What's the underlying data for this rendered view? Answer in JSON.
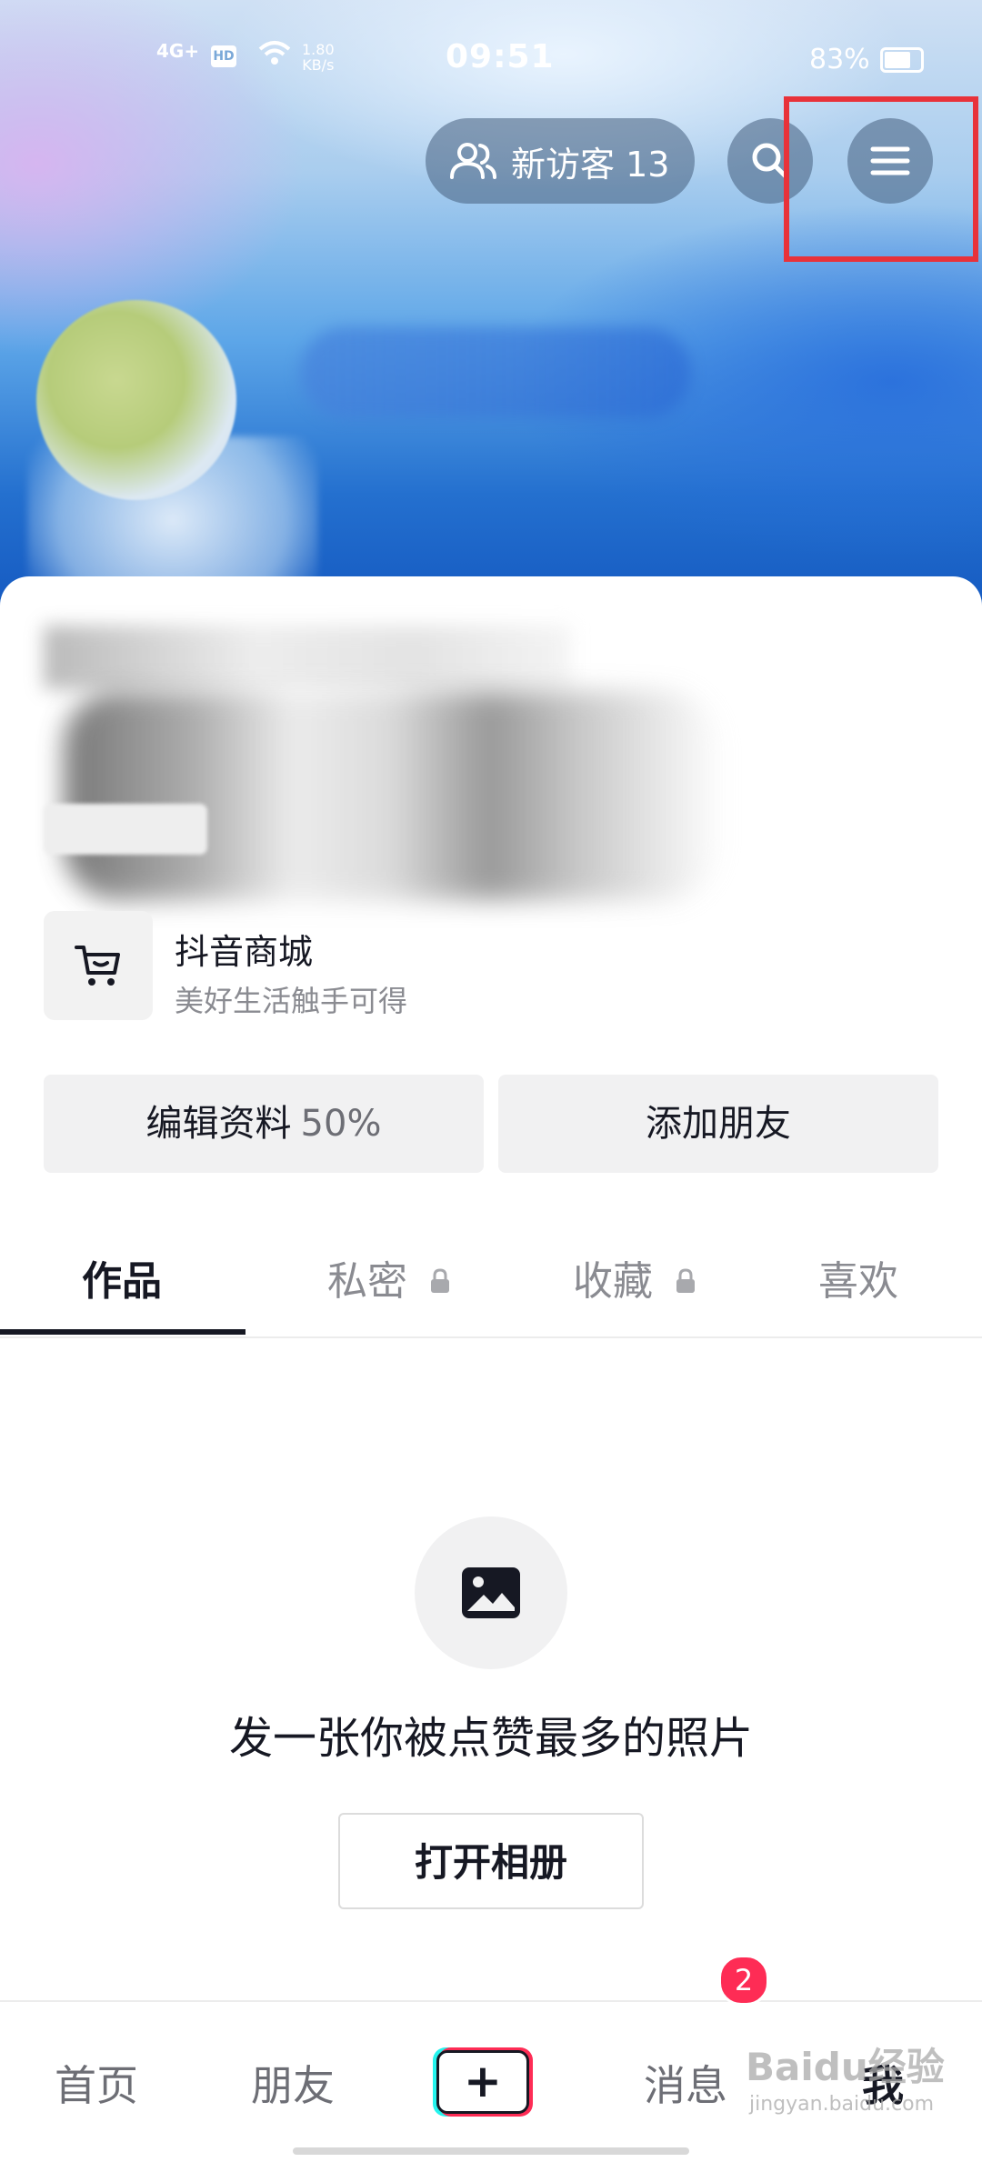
{
  "status_bar": {
    "network": "4G+",
    "hd": "HD",
    "speed": "1.80",
    "speed_unit": "KB/s",
    "time": "09:51",
    "battery_percent": "83%"
  },
  "header": {
    "visitors_label": "新访客 13",
    "icons": [
      "people-icon",
      "search-icon",
      "menu-icon"
    ]
  },
  "shop": {
    "title": "抖音商城",
    "subtitle": "美好生活触手可得",
    "icon": "cart-icon"
  },
  "actions": {
    "edit_label": "编辑资料",
    "edit_percent": "50%",
    "add_friend_label": "添加朋友"
  },
  "tabs": [
    {
      "label": "作品",
      "active": true
    },
    {
      "label": "私密",
      "locked": true
    },
    {
      "label": "收藏",
      "locked": true
    },
    {
      "label": "喜欢"
    }
  ],
  "empty_state": {
    "icon": "image-icon",
    "text": "发一张你被点赞最多的照片",
    "button_label": "打开相册"
  },
  "bottom_nav": {
    "items": [
      "首页",
      "朋友",
      "消息",
      "我"
    ],
    "plus_symbol": "+",
    "message_badge": "2"
  },
  "watermark": {
    "text": "Baidu经验",
    "sub": "jingyan.baidu.com"
  },
  "colors": {
    "highlight": "#e8323a",
    "accent": "#fe2c55",
    "accent_alt": "#25f4ee"
  }
}
